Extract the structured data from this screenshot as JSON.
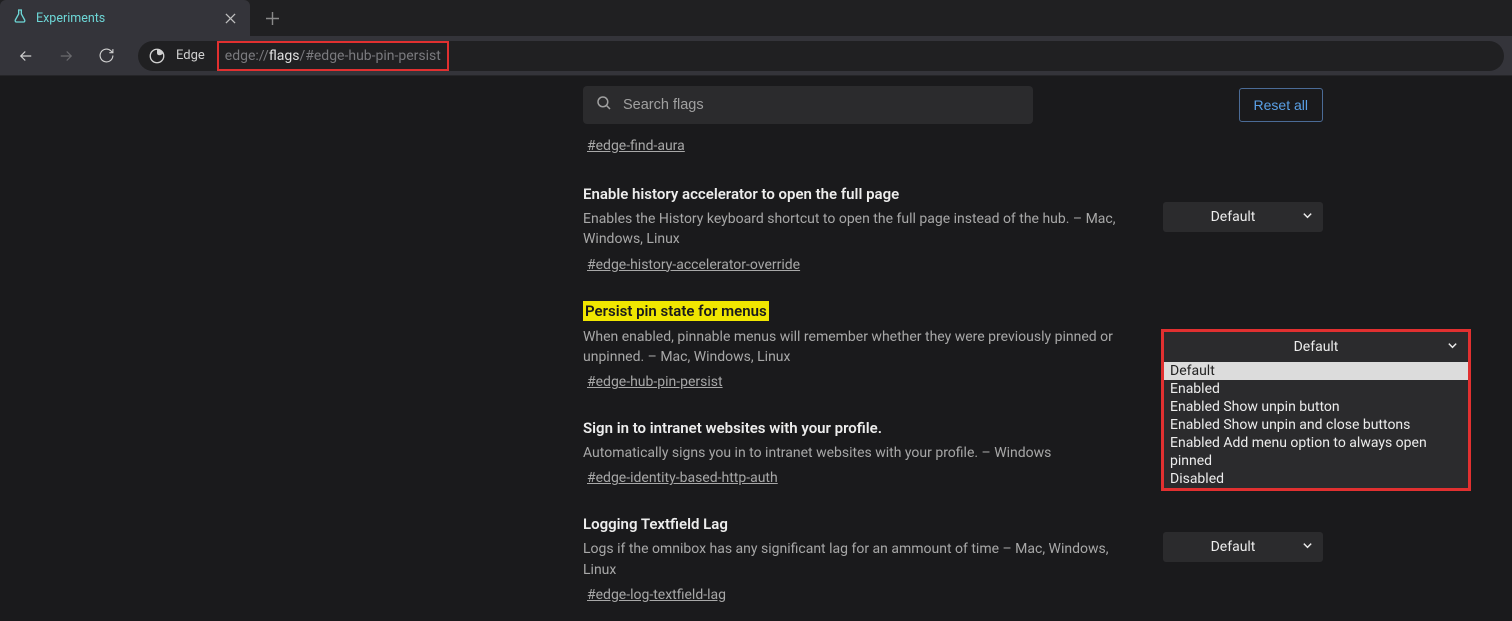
{
  "tab": {
    "title": "Experiments"
  },
  "address": {
    "edge_label": "Edge",
    "url_prefix": "edge://",
    "url_bright": "flags",
    "url_suffix": "/#edge-hub-pin-persist"
  },
  "search": {
    "placeholder": "Search flags"
  },
  "reset_label": "Reset all",
  "top_link": "#edge-find-aura",
  "flags": [
    {
      "title": "Enable history accelerator to open the full page",
      "desc": "Enables the History keyboard shortcut to open the full page instead of the hub. – Mac, Windows, Linux",
      "anchor": "#edge-history-accelerator-override",
      "selected": "Default"
    },
    {
      "title": "Persist pin state for menus",
      "desc": "When enabled, pinnable menus will remember whether they were previously pinned or unpinned. – Mac, Windows, Linux",
      "anchor": "#edge-hub-pin-persist",
      "selected": "Default",
      "highlighted": true,
      "options": [
        "Default",
        "Enabled",
        "Enabled Show unpin button",
        "Enabled Show unpin and close buttons",
        "Enabled Add menu option to always open pinned",
        "Disabled"
      ]
    },
    {
      "title": "Sign in to intranet websites with your profile.",
      "desc": "Automatically signs you in to intranet websites with your profile. – Windows",
      "anchor": "#edge-identity-based-http-auth"
    },
    {
      "title": "Logging Textfield Lag",
      "desc": "Logs if the omnibox has any significant lag for an ammount of time – Mac, Windows, Linux",
      "anchor": "#edge-log-textfield-lag",
      "selected": "Default"
    }
  ]
}
